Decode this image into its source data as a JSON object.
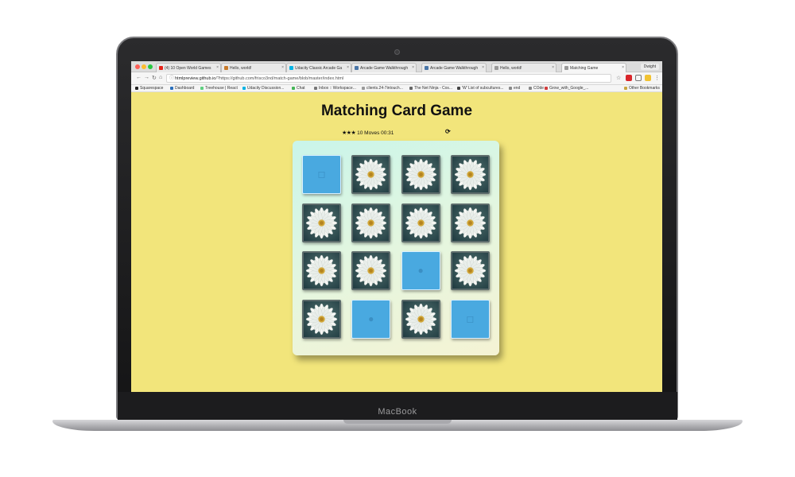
{
  "device": {
    "brand": "MacBook"
  },
  "browser": {
    "tabs": [
      {
        "label": "(4) 10 Open World Games",
        "favicon_color": "#e62117"
      },
      {
        "label": "Hello, world!",
        "favicon_color": "#c77a2b"
      },
      {
        "label": "Udacity Classic Arcade Ga",
        "favicon_color": "#02b3e4"
      },
      {
        "label": "Arcade Game Walkthrough",
        "favicon_color": "#4a76a8"
      },
      {
        "label": "Arcade Game Walkthrough",
        "favicon_color": "#4a76a8"
      },
      {
        "label": "Hello, world!",
        "favicon_color": "#9a9a9a"
      },
      {
        "label": "Matching Game",
        "favicon_color": "#9a9a9a"
      }
    ],
    "profile": "Dwight",
    "url_host": "htmlpreview.github.io",
    "url_rest": "/?https://github.com/frisco3nd/match-game/blob/master/index.html",
    "bookmarks": [
      {
        "label": "Squarespace",
        "color": "#222222"
      },
      {
        "label": "Dashboard",
        "color": "#2a6ebb"
      },
      {
        "label": "Treehouse | React",
        "color": "#5fcf80"
      },
      {
        "label": "Udacity Discussion...",
        "color": "#02b3e4"
      },
      {
        "label": "Chat",
        "color": "#44b556"
      },
      {
        "label": "Inbox :: Workspace...",
        "color": "#777777"
      },
      {
        "label": "clients.24-7intouch...",
        "color": "#999999"
      },
      {
        "label": "The Net Ninja - Cos...",
        "color": "#666666"
      },
      {
        "label": "'W' List of subcultures...",
        "color": "#444444"
      },
      {
        "label": "end",
        "color": "#888888"
      },
      {
        "label": "COde",
        "color": "#888888"
      },
      {
        "label": "Grow_with_Google_...",
        "color": "#d23c3c"
      }
    ],
    "other_bookmarks": "Other Bookmarks"
  },
  "game": {
    "title": "Matching Card Game",
    "stars": "★★★",
    "moves": "10 Moves",
    "timer": "00:31",
    "restart_icon": "⟳",
    "cards": [
      {
        "state": "back",
        "icon": "cube-icon",
        "glyph": "◻"
      },
      {
        "state": "face",
        "icon": "daisy-icon"
      },
      {
        "state": "face",
        "icon": "daisy-icon"
      },
      {
        "state": "face",
        "icon": "daisy-icon"
      },
      {
        "state": "face",
        "icon": "daisy-icon"
      },
      {
        "state": "face",
        "icon": "daisy-icon"
      },
      {
        "state": "face",
        "icon": "daisy-icon"
      },
      {
        "state": "face",
        "icon": "daisy-icon"
      },
      {
        "state": "face",
        "icon": "daisy-icon"
      },
      {
        "state": "face",
        "icon": "daisy-icon"
      },
      {
        "state": "back",
        "icon": "bomb-icon",
        "glyph": "●"
      },
      {
        "state": "face",
        "icon": "daisy-icon"
      },
      {
        "state": "face",
        "icon": "daisy-icon"
      },
      {
        "state": "back",
        "icon": "bomb-icon",
        "glyph": "●"
      },
      {
        "state": "face",
        "icon": "daisy-icon"
      },
      {
        "state": "back",
        "icon": "cube-icon",
        "glyph": "◻"
      }
    ]
  },
  "colors": {
    "page_background": "#f2e57b",
    "card_back": "#49a9e0",
    "deck_start": "#c9f5ea"
  }
}
